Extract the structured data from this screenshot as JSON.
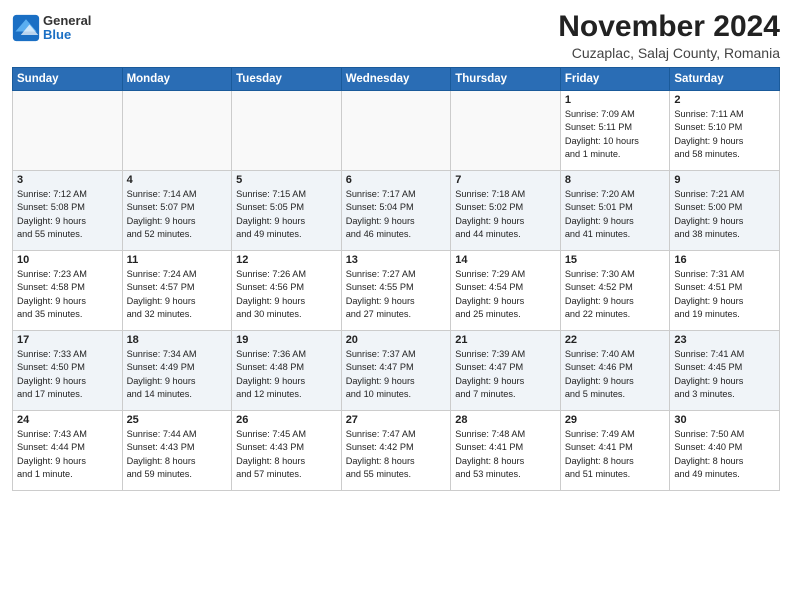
{
  "logo": {
    "general": "General",
    "blue": "Blue"
  },
  "title": "November 2024",
  "location": "Cuzaplac, Salaj County, Romania",
  "weekdays": [
    "Sunday",
    "Monday",
    "Tuesday",
    "Wednesday",
    "Thursday",
    "Friday",
    "Saturday"
  ],
  "weeks": [
    [
      {
        "day": "",
        "info": ""
      },
      {
        "day": "",
        "info": ""
      },
      {
        "day": "",
        "info": ""
      },
      {
        "day": "",
        "info": ""
      },
      {
        "day": "",
        "info": ""
      },
      {
        "day": "1",
        "info": "Sunrise: 7:09 AM\nSunset: 5:11 PM\nDaylight: 10 hours\nand 1 minute."
      },
      {
        "day": "2",
        "info": "Sunrise: 7:11 AM\nSunset: 5:10 PM\nDaylight: 9 hours\nand 58 minutes."
      }
    ],
    [
      {
        "day": "3",
        "info": "Sunrise: 7:12 AM\nSunset: 5:08 PM\nDaylight: 9 hours\nand 55 minutes."
      },
      {
        "day": "4",
        "info": "Sunrise: 7:14 AM\nSunset: 5:07 PM\nDaylight: 9 hours\nand 52 minutes."
      },
      {
        "day": "5",
        "info": "Sunrise: 7:15 AM\nSunset: 5:05 PM\nDaylight: 9 hours\nand 49 minutes."
      },
      {
        "day": "6",
        "info": "Sunrise: 7:17 AM\nSunset: 5:04 PM\nDaylight: 9 hours\nand 46 minutes."
      },
      {
        "day": "7",
        "info": "Sunrise: 7:18 AM\nSunset: 5:02 PM\nDaylight: 9 hours\nand 44 minutes."
      },
      {
        "day": "8",
        "info": "Sunrise: 7:20 AM\nSunset: 5:01 PM\nDaylight: 9 hours\nand 41 minutes."
      },
      {
        "day": "9",
        "info": "Sunrise: 7:21 AM\nSunset: 5:00 PM\nDaylight: 9 hours\nand 38 minutes."
      }
    ],
    [
      {
        "day": "10",
        "info": "Sunrise: 7:23 AM\nSunset: 4:58 PM\nDaylight: 9 hours\nand 35 minutes."
      },
      {
        "day": "11",
        "info": "Sunrise: 7:24 AM\nSunset: 4:57 PM\nDaylight: 9 hours\nand 32 minutes."
      },
      {
        "day": "12",
        "info": "Sunrise: 7:26 AM\nSunset: 4:56 PM\nDaylight: 9 hours\nand 30 minutes."
      },
      {
        "day": "13",
        "info": "Sunrise: 7:27 AM\nSunset: 4:55 PM\nDaylight: 9 hours\nand 27 minutes."
      },
      {
        "day": "14",
        "info": "Sunrise: 7:29 AM\nSunset: 4:54 PM\nDaylight: 9 hours\nand 25 minutes."
      },
      {
        "day": "15",
        "info": "Sunrise: 7:30 AM\nSunset: 4:52 PM\nDaylight: 9 hours\nand 22 minutes."
      },
      {
        "day": "16",
        "info": "Sunrise: 7:31 AM\nSunset: 4:51 PM\nDaylight: 9 hours\nand 19 minutes."
      }
    ],
    [
      {
        "day": "17",
        "info": "Sunrise: 7:33 AM\nSunset: 4:50 PM\nDaylight: 9 hours\nand 17 minutes."
      },
      {
        "day": "18",
        "info": "Sunrise: 7:34 AM\nSunset: 4:49 PM\nDaylight: 9 hours\nand 14 minutes."
      },
      {
        "day": "19",
        "info": "Sunrise: 7:36 AM\nSunset: 4:48 PM\nDaylight: 9 hours\nand 12 minutes."
      },
      {
        "day": "20",
        "info": "Sunrise: 7:37 AM\nSunset: 4:47 PM\nDaylight: 9 hours\nand 10 minutes."
      },
      {
        "day": "21",
        "info": "Sunrise: 7:39 AM\nSunset: 4:47 PM\nDaylight: 9 hours\nand 7 minutes."
      },
      {
        "day": "22",
        "info": "Sunrise: 7:40 AM\nSunset: 4:46 PM\nDaylight: 9 hours\nand 5 minutes."
      },
      {
        "day": "23",
        "info": "Sunrise: 7:41 AM\nSunset: 4:45 PM\nDaylight: 9 hours\nand 3 minutes."
      }
    ],
    [
      {
        "day": "24",
        "info": "Sunrise: 7:43 AM\nSunset: 4:44 PM\nDaylight: 9 hours\nand 1 minute."
      },
      {
        "day": "25",
        "info": "Sunrise: 7:44 AM\nSunset: 4:43 PM\nDaylight: 8 hours\nand 59 minutes."
      },
      {
        "day": "26",
        "info": "Sunrise: 7:45 AM\nSunset: 4:43 PM\nDaylight: 8 hours\nand 57 minutes."
      },
      {
        "day": "27",
        "info": "Sunrise: 7:47 AM\nSunset: 4:42 PM\nDaylight: 8 hours\nand 55 minutes."
      },
      {
        "day": "28",
        "info": "Sunrise: 7:48 AM\nSunset: 4:41 PM\nDaylight: 8 hours\nand 53 minutes."
      },
      {
        "day": "29",
        "info": "Sunrise: 7:49 AM\nSunset: 4:41 PM\nDaylight: 8 hours\nand 51 minutes."
      },
      {
        "day": "30",
        "info": "Sunrise: 7:50 AM\nSunset: 4:40 PM\nDaylight: 8 hours\nand 49 minutes."
      }
    ]
  ]
}
